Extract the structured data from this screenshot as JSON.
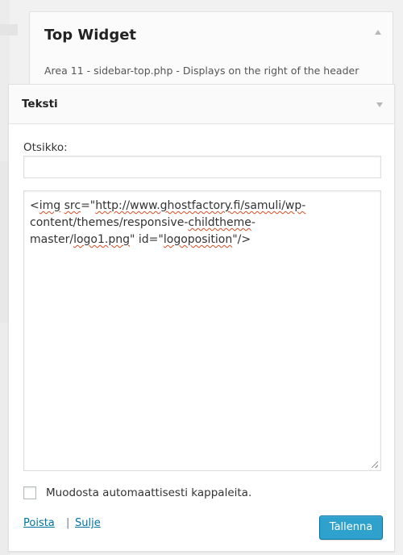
{
  "sidebar": {
    "title": "Top Widget",
    "description": "Area 11 - sidebar-top.php - Displays on the right of the header"
  },
  "widget": {
    "title": "Teksti",
    "title_label": "Otsikko:",
    "title_value": "",
    "content_lines": {
      "l1_a": "<",
      "l1_b": "img",
      "l1_c": " ",
      "l1_d": "src",
      "l1_e": "=\"",
      "l1_f": "http://www.ghostfactory.fi/samuli/wp-",
      "l2_a": "content/themes/responsive-",
      "l2_b": "childtheme",
      "l2_c": "-",
      "l3_a": "master/",
      "l3_b": "logo1.png",
      "l3_c": "\" id=\"",
      "l3_d": "logoposition",
      "l3_e": "\"/>"
    },
    "auto_paragraph_label": "Muodosta automaattisesti kappaleita.",
    "auto_paragraph_checked": false,
    "delete_link": "Poista",
    "separator": "|",
    "close_link": "Sulje",
    "save_button": "Tallenna"
  },
  "colors": {
    "accent": "#2ea2cc",
    "link": "#0074a2",
    "spellcheck": "#d54e21"
  },
  "icons": {
    "sidebar_toggle": "arrow-up-icon",
    "widget_toggle": "arrow-down-icon",
    "resize": "resize-handle-icon"
  }
}
